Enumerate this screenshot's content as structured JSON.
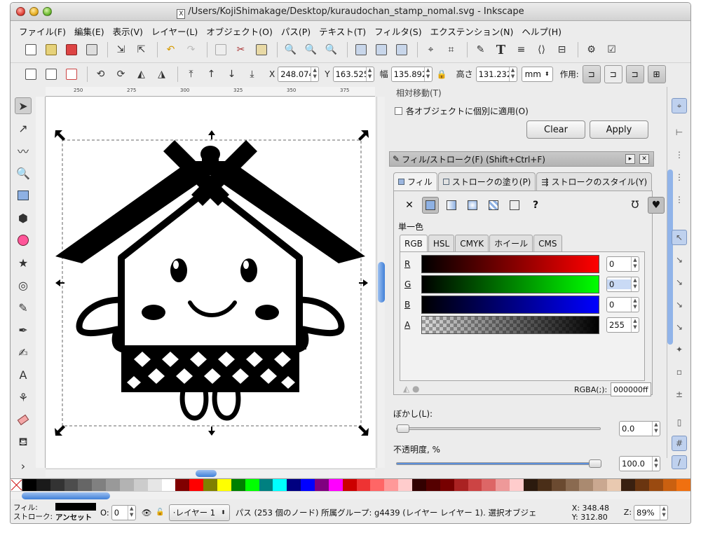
{
  "window": {
    "title": "/Users/KojiShimakage/Desktop/kuraudochan_stamp_nomal.svg - Inkscape"
  },
  "menu": [
    "ファイル(F)",
    "編集(E)",
    "表示(V)",
    "レイヤー(L)",
    "オブジェクト(O)",
    "パス(P)",
    "テキスト(T)",
    "フィルタ(S)",
    "エクステンション(N)",
    "ヘルプ(H)"
  ],
  "select_toolbar": {
    "x_label": "X",
    "x_value": "248.074",
    "y_label": "Y",
    "y_value": "163.525",
    "w_label": "幅",
    "w_value": "135.892",
    "h_label": "高さ",
    "h_value": "131.232",
    "unit": "mm",
    "affect_label": "作用:"
  },
  "ruler": {
    "ticks": [
      "250",
      "275",
      "300",
      "325",
      "350",
      "375"
    ]
  },
  "transform_panel": {
    "cut_text": "相対移動(T)",
    "apply_each_label": "各オブジェクトに個別に適用(O)",
    "clear_label": "Clear",
    "apply_label": "Apply"
  },
  "fill_stroke": {
    "title": "フィル/ストローク(F) (Shift+Ctrl+F)",
    "tabs": [
      "フィル",
      "ストロークの塗り(P)",
      "ストロークのスタイル(Y)"
    ],
    "flat_color_label": "単一色",
    "color_tabs": [
      "RGB",
      "HSL",
      "CMYK",
      "ホイール",
      "CMS"
    ],
    "channels": [
      {
        "label": "R",
        "value": "0"
      },
      {
        "label": "G",
        "value": "0"
      },
      {
        "label": "B",
        "value": "0"
      },
      {
        "label": "A",
        "value": "255"
      }
    ],
    "rgba_label": "RGBA(;):",
    "rgba_value": "000000ff",
    "blur_label": "ぼかし(L):",
    "blur_value": "0.0",
    "opacity_label": "不透明度, %",
    "opacity_value": "100.0",
    "blur_level": 0,
    "opacity_level": 1.0
  },
  "statusbar": {
    "fill_label": "フィル:",
    "stroke_label": "ストローク:",
    "stroke_value": "アンセット",
    "o_label": "O:",
    "o_value": "0",
    "layer": "·レイヤー 1",
    "message": "パス (253 個のノード) 所属グループ: g4439 (レイヤー レイヤー 1). 選択オブジェ",
    "x_coord": "X: 348.48",
    "y_coord": "Y: 312.80",
    "zoom_label": "Z:",
    "zoom_value": "89%"
  },
  "colors": {
    "fill": "#000000",
    "accent": "#3f7fd8"
  },
  "icons": [
    "new-icon",
    "open-icon",
    "save-icon",
    "print-icon",
    "import-icon",
    "export-icon",
    "undo-icon",
    "redo-icon",
    "duplicate-icon",
    "cut-icon",
    "paste-icon",
    "zoom-selection-icon",
    "zoom-drawing-icon",
    "zoom-page-icon",
    "group-icon",
    "ungroup-icon",
    "node-icon",
    "xml-editor-icon",
    "text-icon",
    "layers-icon",
    "align-icon",
    "preferences-icon"
  ]
}
